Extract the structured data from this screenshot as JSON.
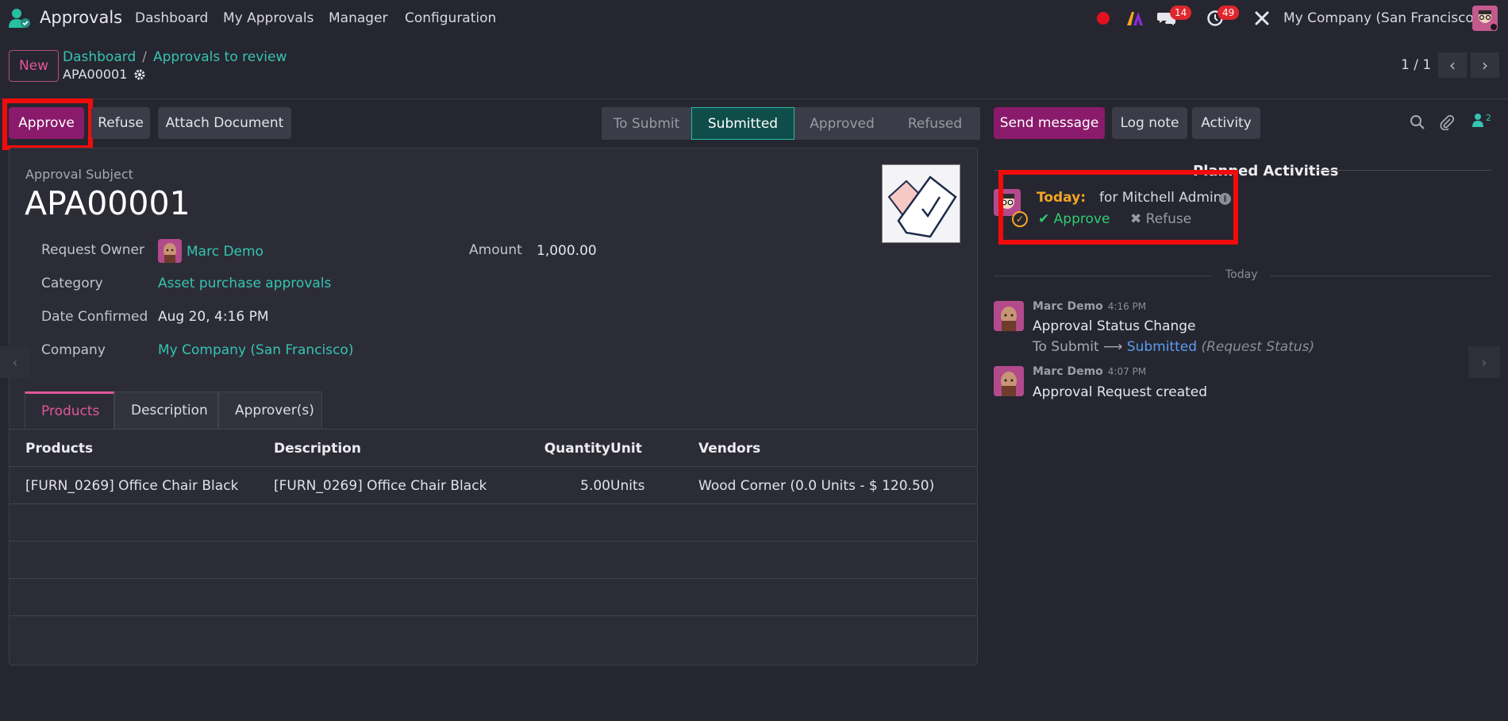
{
  "app": {
    "name": "Approvals",
    "menu": [
      "Dashboard",
      "My Approvals",
      "Manager",
      "Configuration"
    ],
    "messages_badge": "14",
    "activities_badge": "49",
    "company": "My Company (San Francisco)"
  },
  "control": {
    "new_label": "New",
    "breadcrumb": [
      "Dashboard",
      "Approvals to review"
    ],
    "breadcrumb_sep": "/",
    "record_ref": "APA00001",
    "pager": "1 / 1"
  },
  "actions": {
    "approve": "Approve",
    "refuse": "Refuse",
    "attach": "Attach Document"
  },
  "status": {
    "stages": [
      "To Submit",
      "Submitted",
      "Approved",
      "Refused"
    ],
    "current": "Submitted"
  },
  "form": {
    "subject_label": "Approval Subject",
    "subject": "APA00001",
    "fields": {
      "owner_label": "Request Owner",
      "owner": "Marc Demo",
      "category_label": "Category",
      "category": "Asset purchase approvals",
      "date_label": "Date Confirmed",
      "date": "Aug 20, 4:16 PM",
      "company_label": "Company",
      "company": "My Company (San Francisco)",
      "amount_label": "Amount",
      "amount": "1,000.00"
    },
    "tabs": [
      "Products",
      "Description",
      "Approver(s)"
    ],
    "table": {
      "headers": [
        "Products",
        "Description",
        "Quantity",
        "Unit",
        "Vendors"
      ],
      "rows": [
        [
          "[FURN_0269] Office Chair Black",
          "[FURN_0269] Office Chair Black",
          "5.00",
          "Units",
          "Wood Corner (0.0 Units - $ 120.50)"
        ]
      ]
    }
  },
  "chatter": {
    "send_message": "Send message",
    "log_note": "Log note",
    "activity": "Activity",
    "followers_count": "2",
    "planned_title": "Planned Activities",
    "activity_item": {
      "when": "Today:",
      "for": "for Mitchell Admin",
      "approve": "Approve",
      "refuse": "Refuse"
    },
    "date_separator": "Today",
    "messages": [
      {
        "author": "Marc Demo",
        "time": "4:16 PM",
        "body": "Approval Status Change",
        "old_value": "To Submit",
        "new_value": "Submitted",
        "field": "(Request Status)"
      },
      {
        "author": "Marc Demo",
        "time": "4:07 PM",
        "body": "Approval Request created"
      }
    ]
  },
  "colors": {
    "background": "#262630",
    "accent": "#8a1a6b",
    "link": "#35c4b0",
    "status_active": "#0f4d4a",
    "highlight_box": "#f10b0b"
  }
}
